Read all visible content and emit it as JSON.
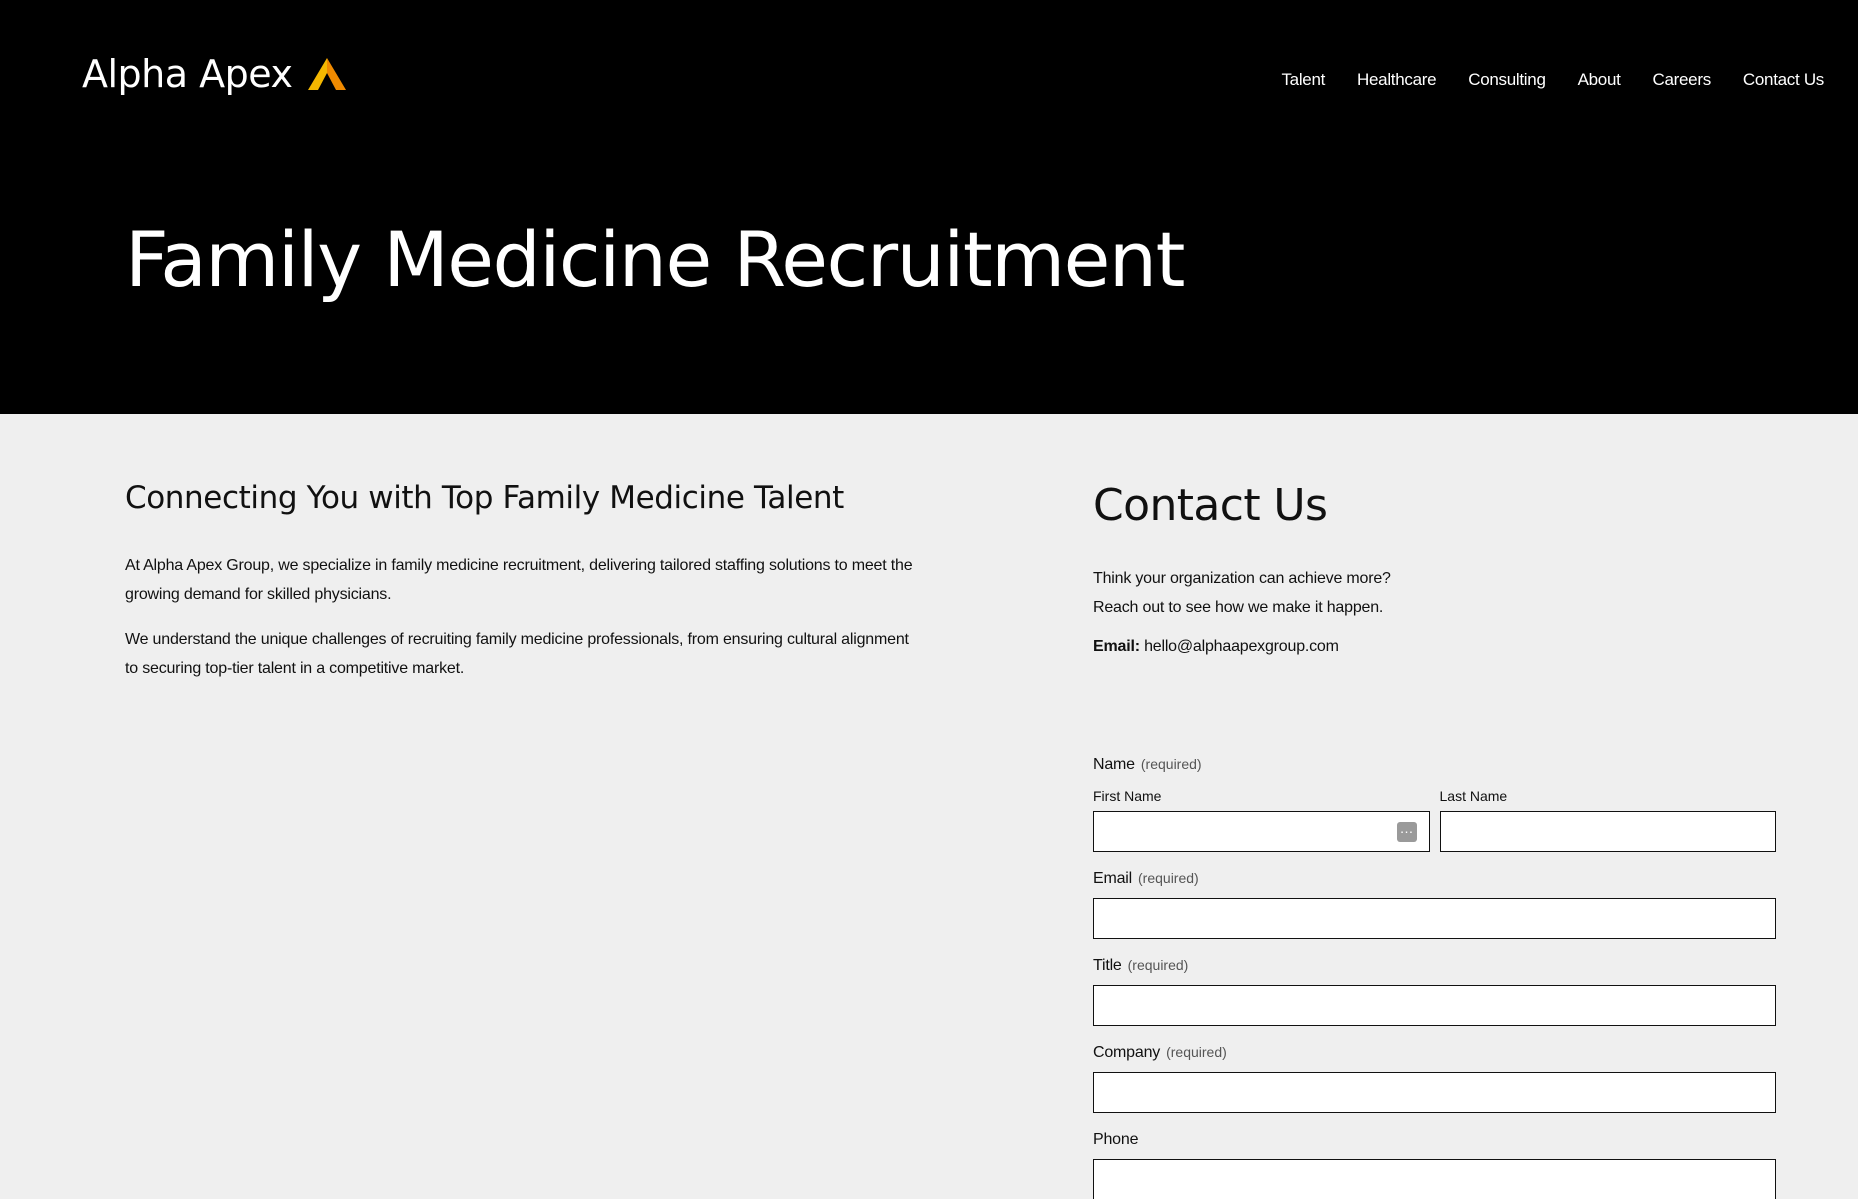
{
  "header": {
    "brand": "Alpha Apex",
    "logo_icon": "triangle-a-icon",
    "nav": [
      {
        "label": "Talent"
      },
      {
        "label": "Healthcare"
      },
      {
        "label": "Consulting"
      },
      {
        "label": "About"
      },
      {
        "label": "Careers"
      },
      {
        "label": "Contact Us"
      }
    ]
  },
  "hero": {
    "title": "Family Medicine Recruitment"
  },
  "intro": {
    "heading": "Connecting You with Top Family Medicine Talent",
    "paragraphs": [
      "At Alpha Apex Group, we specialize in family medicine recruitment, delivering tailored staffing solutions to meet the growing demand for skilled physicians.",
      "We understand the unique challenges of recruiting family medicine professionals, from ensuring cultural alignment to securing top-tier talent in a competitive market."
    ]
  },
  "contact": {
    "heading": "Contact Us",
    "line1": "Think your organization can achieve more?",
    "line2": "Reach out to see how we make it happen.",
    "email_label": "Email:",
    "email_value": "hello@alphaapexgroup.com"
  },
  "form": {
    "name_label": "Name",
    "required_text": "(required)",
    "first_name_label": "First Name",
    "last_name_label": "Last Name",
    "email_label": "Email",
    "title_label": "Title",
    "company_label": "Company",
    "phone_label": "Phone"
  },
  "colors": {
    "hero_bg": "#000000",
    "page_bg": "#efefef",
    "logo_yellow": "#f5b800",
    "logo_orange": "#f08a00"
  }
}
